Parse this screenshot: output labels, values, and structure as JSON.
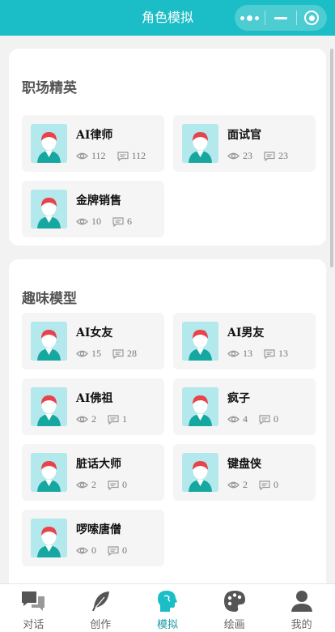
{
  "header": {
    "title": "角色模拟"
  },
  "colors": {
    "accent": "#1bbec6",
    "avatar_bg": "#b3e8ec",
    "active_tab": "#1b9aa1"
  },
  "sections": [
    {
      "title": "职场精英",
      "cards": [
        {
          "name": "AI律师",
          "views": "112",
          "comments": "112"
        },
        {
          "name": "面试官",
          "views": "23",
          "comments": "23"
        },
        {
          "name": "金牌销售",
          "views": "10",
          "comments": "6"
        }
      ]
    },
    {
      "title": "趣味模型",
      "cards": [
        {
          "name": "AI女友",
          "views": "15",
          "comments": "28"
        },
        {
          "name": "AI男友",
          "views": "13",
          "comments": "13"
        },
        {
          "name": "AI佛祖",
          "views": "2",
          "comments": "1"
        },
        {
          "name": "疯子",
          "views": "4",
          "comments": "0"
        },
        {
          "name": "脏话大师",
          "views": "2",
          "comments": "0"
        },
        {
          "name": "键盘侠",
          "views": "2",
          "comments": "0"
        },
        {
          "name": "啰嗦唐僧",
          "views": "0",
          "comments": "0"
        }
      ]
    }
  ],
  "tabbar": {
    "items": [
      {
        "label": "对话",
        "icon": "chat-icon"
      },
      {
        "label": "创作",
        "icon": "feather-icon"
      },
      {
        "label": "模拟",
        "icon": "head-profile-icon",
        "active": true
      },
      {
        "label": "绘画",
        "icon": "palette-icon"
      },
      {
        "label": "我的",
        "icon": "user-icon"
      }
    ]
  }
}
